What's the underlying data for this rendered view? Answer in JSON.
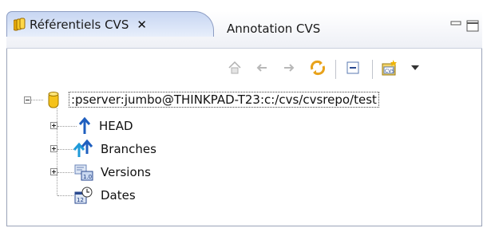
{
  "tabs": [
    {
      "label": "Référentiels CVS",
      "active": true,
      "close": "✕"
    },
    {
      "label": "Annotation CVS",
      "active": false
    }
  ],
  "toolbar": {
    "buttons": [
      "home-icon",
      "back-icon",
      "forward-icon",
      "refresh-icon",
      "collapse-all-icon",
      "new-repository-icon",
      "view-menu-icon"
    ]
  },
  "tree": {
    "root": ":pserver:jumbo@THINKPAD-T23:c:/cvs/cvsrepo/test",
    "children": [
      {
        "label": "HEAD",
        "icon": "head-branch-icon"
      },
      {
        "label": "Branches",
        "icon": "branches-icon"
      },
      {
        "label": "Versions",
        "icon": "versions-icon"
      },
      {
        "label": "Dates",
        "icon": "dates-icon"
      }
    ]
  },
  "colors": {
    "tab_active": "#c7d6f2",
    "repo_icon": "#f2c218",
    "arrow_blue": "#1f5fbf"
  }
}
